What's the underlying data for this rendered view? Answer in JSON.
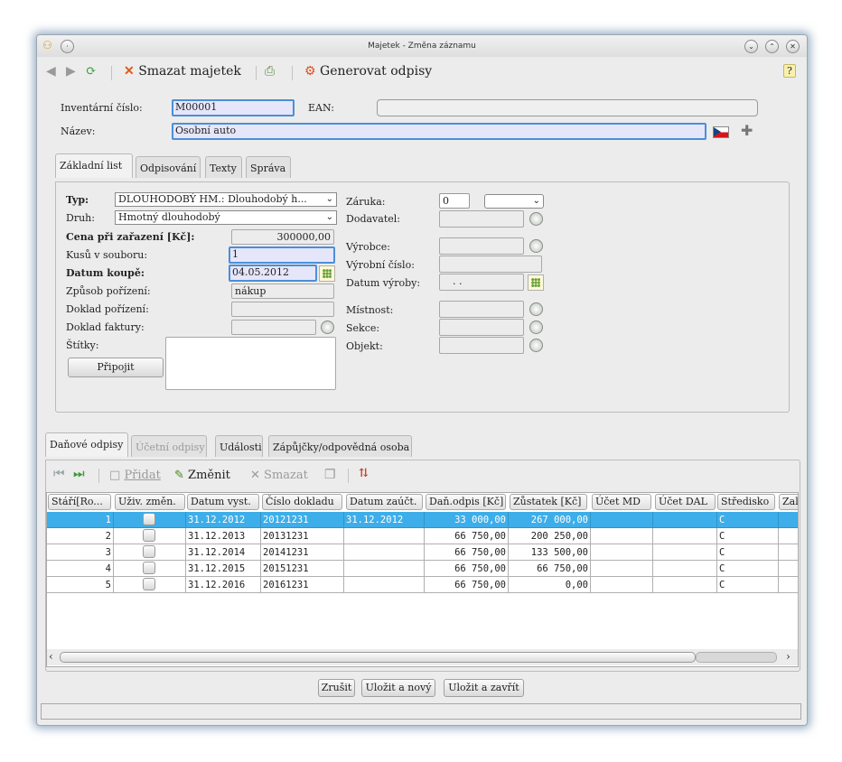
{
  "window": {
    "title": "Majetek - Změna záznamu"
  },
  "toolbar": {
    "delete_label": "Smazat majetek",
    "generate_label": "Generovat odpisy"
  },
  "form": {
    "inv_label": "Inventární číslo:",
    "inv_value": "M00001",
    "ean_label": "EAN:",
    "ean_value": "",
    "name_label": "Název:",
    "name_value": "Osobní auto"
  },
  "tabs_top": [
    "Základní list",
    "Odpisování",
    "Texty",
    "Správa"
  ],
  "basic": {
    "typ_label": "Typ:",
    "typ_value": "DLOUHODOBÝ HM.: Dlouhodobý h...",
    "druh_label": "Druh:",
    "druh_value": "Hmotný dlouhodobý",
    "cena_label": "Cena při zařazení [Kč]:",
    "cena_value": "300000,00",
    "kusu_label": "Kusů v souboru:",
    "kusu_value": "1",
    "datum_label": "Datum koupě:",
    "datum_value": "04.05.2012",
    "zpusob_label": "Způsob pořízení:",
    "zpusob_value": "nákup",
    "doklad_por_label": "Doklad pořízení:",
    "doklad_por_value": "",
    "doklad_fak_label": "Doklad faktury:",
    "doklad_fak_value": "",
    "stitky_label": "Štítky:",
    "pripojit_label": "Připojit",
    "zaruka_label": "Záruka:",
    "zaruka_value": "0",
    "zaruka_unit": "",
    "dodavatel_label": "Dodavatel:",
    "vyrobce_label": "Výrobce:",
    "vyrobni_label": "Výrobní číslo:",
    "datum_vyr_label": "Datum výroby:",
    "datum_vyr_value": ". .",
    "mistnost_label": "Místnost:",
    "sekce_label": "Sekce:",
    "objekt_label": "Objekt:"
  },
  "tabs_bottom": [
    "Daňové odpisy",
    "Účetní odpisy",
    "Události",
    "Zápůjčky/odpovědná osoba"
  ],
  "gridbar": {
    "add_label": "Přidat",
    "edit_label": "Změnit",
    "delete_label": "Smazat"
  },
  "grid": {
    "headers": [
      "Stáří[Ro...",
      "Uživ. změn.",
      "Datum vyst.",
      "Číslo dokladu",
      "Datum zaúčt.",
      "Daň.odpis [Kč]",
      "Zůstatek [Kč]",
      "Účet MD",
      "Účet DAL",
      "Středisko",
      "Zal"
    ],
    "rows": [
      [
        "1",
        "",
        "31.12.2012",
        "20121231",
        "31.12.2012",
        "33 000,00",
        "267 000,00",
        "",
        "",
        "C",
        ""
      ],
      [
        "2",
        "",
        "31.12.2013",
        "20131231",
        "",
        "66 750,00",
        "200 250,00",
        "",
        "",
        "C",
        ""
      ],
      [
        "3",
        "",
        "31.12.2014",
        "20141231",
        "",
        "66 750,00",
        "133 500,00",
        "",
        "",
        "C",
        ""
      ],
      [
        "4",
        "",
        "31.12.2015",
        "20151231",
        "",
        "66 750,00",
        "66 750,00",
        "",
        "",
        "C",
        ""
      ],
      [
        "5",
        "",
        "31.12.2016",
        "20161231",
        "",
        "66 750,00",
        "0,00",
        "",
        "",
        "C",
        ""
      ]
    ]
  },
  "footer": {
    "cancel_label": "Zrušit",
    "save_new_label": "Uložit a nový",
    "save_close_label": "Uložit a zavřít"
  },
  "colors": {
    "accent": "#3daee9",
    "focus": "#4b8fd6"
  }
}
